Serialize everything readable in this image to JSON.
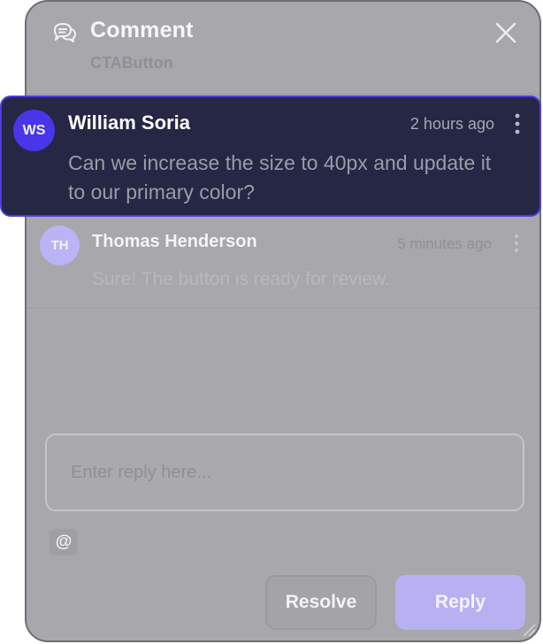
{
  "header": {
    "title": "Comment",
    "subtitle": "CTAButton",
    "icon": "chat-bubbles-icon",
    "close_icon": "close-icon"
  },
  "comments": [
    {
      "initials": "WS",
      "author": "William Soria",
      "time": "2 hours ago",
      "body": "Can we increase the size to 40px and update it to our primary color?",
      "avatar_color": "#4836e8",
      "highlighted": true
    },
    {
      "initials": "TH",
      "author": "Thomas Henderson",
      "time": "5 minutes ago",
      "body": "Sure! The button is ready for review.",
      "avatar_color": "#bab3f5",
      "highlighted": false
    }
  ],
  "reply": {
    "placeholder": "Enter reply here...",
    "value": "",
    "mention_symbol": "@"
  },
  "actions": {
    "resolve_label": "Resolve",
    "reply_label": "Reply"
  },
  "colors": {
    "accent": "#4b3ce0",
    "highlight_card": "#262645",
    "overlay": "#a7a7ac"
  }
}
